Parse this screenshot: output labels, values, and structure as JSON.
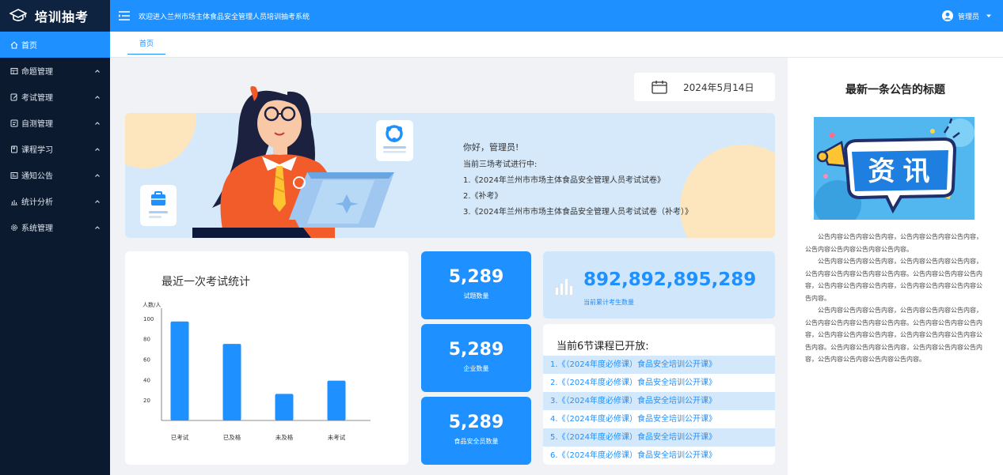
{
  "app": {
    "logo_text": "培训抽考"
  },
  "header": {
    "welcome": "欢迎进入兰州市场主体食品安全管理人员培训抽考系统",
    "user": "管理员"
  },
  "sidebar": {
    "items": [
      {
        "label": "首页",
        "icon": "home-icon"
      },
      {
        "label": "命题管理",
        "icon": "question-bank-icon"
      },
      {
        "label": "考试管理",
        "icon": "exam-edit-icon"
      },
      {
        "label": "自测管理",
        "icon": "self-test-icon"
      },
      {
        "label": "课程学习",
        "icon": "course-icon"
      },
      {
        "label": "通知公告",
        "icon": "notice-icon"
      },
      {
        "label": "统计分析",
        "icon": "stats-icon"
      },
      {
        "label": "系统管理",
        "icon": "settings-icon"
      }
    ]
  },
  "tabs": [
    {
      "label": "首页"
    }
  ],
  "date": "2024年5月14日",
  "banner": {
    "greeting": "你好，管理员!",
    "subtitle": "当前三场考试进行中:",
    "exams": [
      "1.《2024年兰州市市场主体食品安全管理人员考试试卷》",
      "2.《补考》",
      "3.《2024年兰州市市场主体食品安全管理人员考试试卷（补考）》"
    ]
  },
  "chart": {
    "title": "最近一次考试统计"
  },
  "chart_data": {
    "type": "bar",
    "title": "最近一次考试统计",
    "ylabel": "人数/人",
    "categories": [
      "已考试",
      "已及格",
      "未及格",
      "未考试"
    ],
    "values": [
      97,
      75,
      26,
      39
    ],
    "yticks": [
      "100",
      "80",
      "60",
      "40",
      "20"
    ],
    "ylim": [
      0,
      110
    ],
    "color": "#1e90ff"
  },
  "stats": [
    {
      "value": "5,289",
      "label": "试题数量"
    },
    {
      "value": "5,289",
      "label": "企业数量"
    },
    {
      "value": "5,289",
      "label": "食品安全员数量"
    }
  ],
  "total": {
    "value": "892,892,895,289",
    "label": "当前累计考生数量"
  },
  "courses": {
    "title": "当前6节课程已开放:",
    "items": [
      "1.《（2024年度必修课）食品安全培训公开课》",
      "2.《（2024年度必修课）食品安全培训公开课》",
      "3.《（2024年度必修课）食品安全培训公开课》",
      "4.《（2024年度必修课）食品安全培训公开课》",
      "5.《（2024年度必修课）食品安全培训公开课》",
      "6.《（2024年度必修课）食品安全培训公开课》"
    ]
  },
  "announcement": {
    "title": "最新一条公告的标题",
    "image_text": "资讯",
    "paragraphs": [
      "公告内容公告内容公告内容，公告内容公告内容公告内容，公告内容公告内容公告内容公告内容。",
      "公告内容公告内容公告内容，公告内容公告内容公告内容，公告内容公告内容公告内容公告内容。公告内容公告内容公告内容，公告内容公告内容公告内容，公告内容公告内容公告内容公告内容。",
      "公告内容公告内容公告内容，公告内容公告内容公告内容，公告内容公告内容公告内容公告内容。公告内容公告内容公告内容，公告内容公告内容公告内容，公告内容公告内容公告内容公告内容。公告内容公告内容公告内容，公告内容公告内容公告内容，公告内容公告内容公告内容公告内容。"
    ]
  }
}
